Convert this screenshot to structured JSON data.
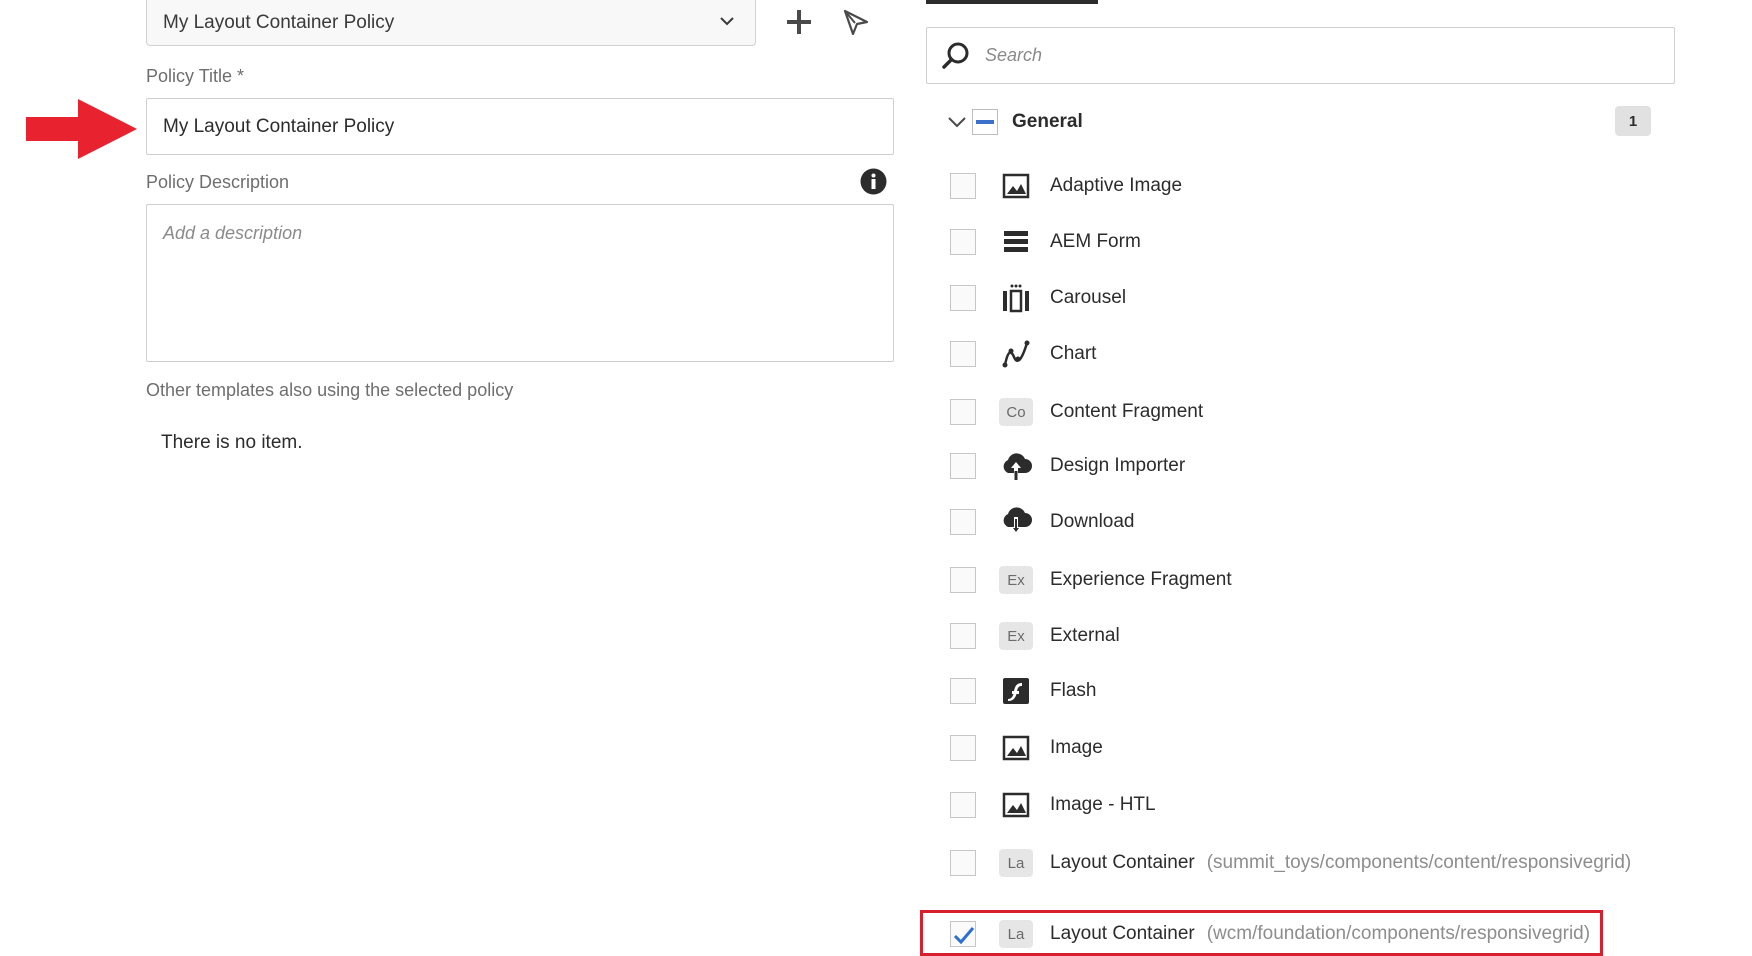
{
  "policy_selector": {
    "value": "My Layout Container Policy",
    "icons": [
      "chevron-down-icon",
      "add-icon",
      "select-cursor-icon"
    ]
  },
  "policy_title": {
    "label": "Policy Title *",
    "value": "My Layout Container Policy"
  },
  "policy_description": {
    "label": "Policy Description",
    "placeholder": "Add a description",
    "info_icon": "info-icon"
  },
  "other_templates": {
    "label": "Other templates also using the selected policy",
    "empty_text": "There is no item."
  },
  "annotation": {
    "arrow_color": "#e8232f",
    "highlight_color": "#d7202e"
  },
  "search": {
    "placeholder": "Search",
    "icon": "search-icon"
  },
  "group": {
    "title": "General",
    "count": "1",
    "state": "indeterminate",
    "accent": "#3a70c9"
  },
  "components": [
    {
      "label": "Adaptive Image",
      "path": "",
      "icon": "image-icon",
      "checked": false
    },
    {
      "label": "AEM Form",
      "path": "",
      "icon": "form-icon",
      "checked": false
    },
    {
      "label": "Carousel",
      "path": "",
      "icon": "carousel-icon",
      "checked": false
    },
    {
      "label": "Chart",
      "path": "",
      "icon": "chart-icon",
      "checked": false
    },
    {
      "label": "Content Fragment",
      "path": "",
      "icon": "Co",
      "checked": false
    },
    {
      "label": "Design Importer",
      "path": "",
      "icon": "upload-cloud-icon",
      "checked": false
    },
    {
      "label": "Download",
      "path": "",
      "icon": "download-cloud-icon",
      "checked": false
    },
    {
      "label": "Experience Fragment",
      "path": "",
      "icon": "Ex",
      "checked": false
    },
    {
      "label": "External",
      "path": "",
      "icon": "Ex",
      "checked": false
    },
    {
      "label": "Flash",
      "path": "",
      "icon": "flash-icon",
      "checked": false
    },
    {
      "label": "Image",
      "path": "",
      "icon": "image-icon",
      "checked": false
    },
    {
      "label": "Image - HTL",
      "path": "",
      "icon": "image-icon",
      "checked": false
    },
    {
      "label": "Layout Container",
      "path": "(summit_toys/components/content/responsivegrid)",
      "icon": "La",
      "checked": false
    },
    {
      "label": "Layout Container",
      "path": "(wcm/foundation/components/responsivegrid)",
      "icon": "La",
      "checked": true
    }
  ]
}
